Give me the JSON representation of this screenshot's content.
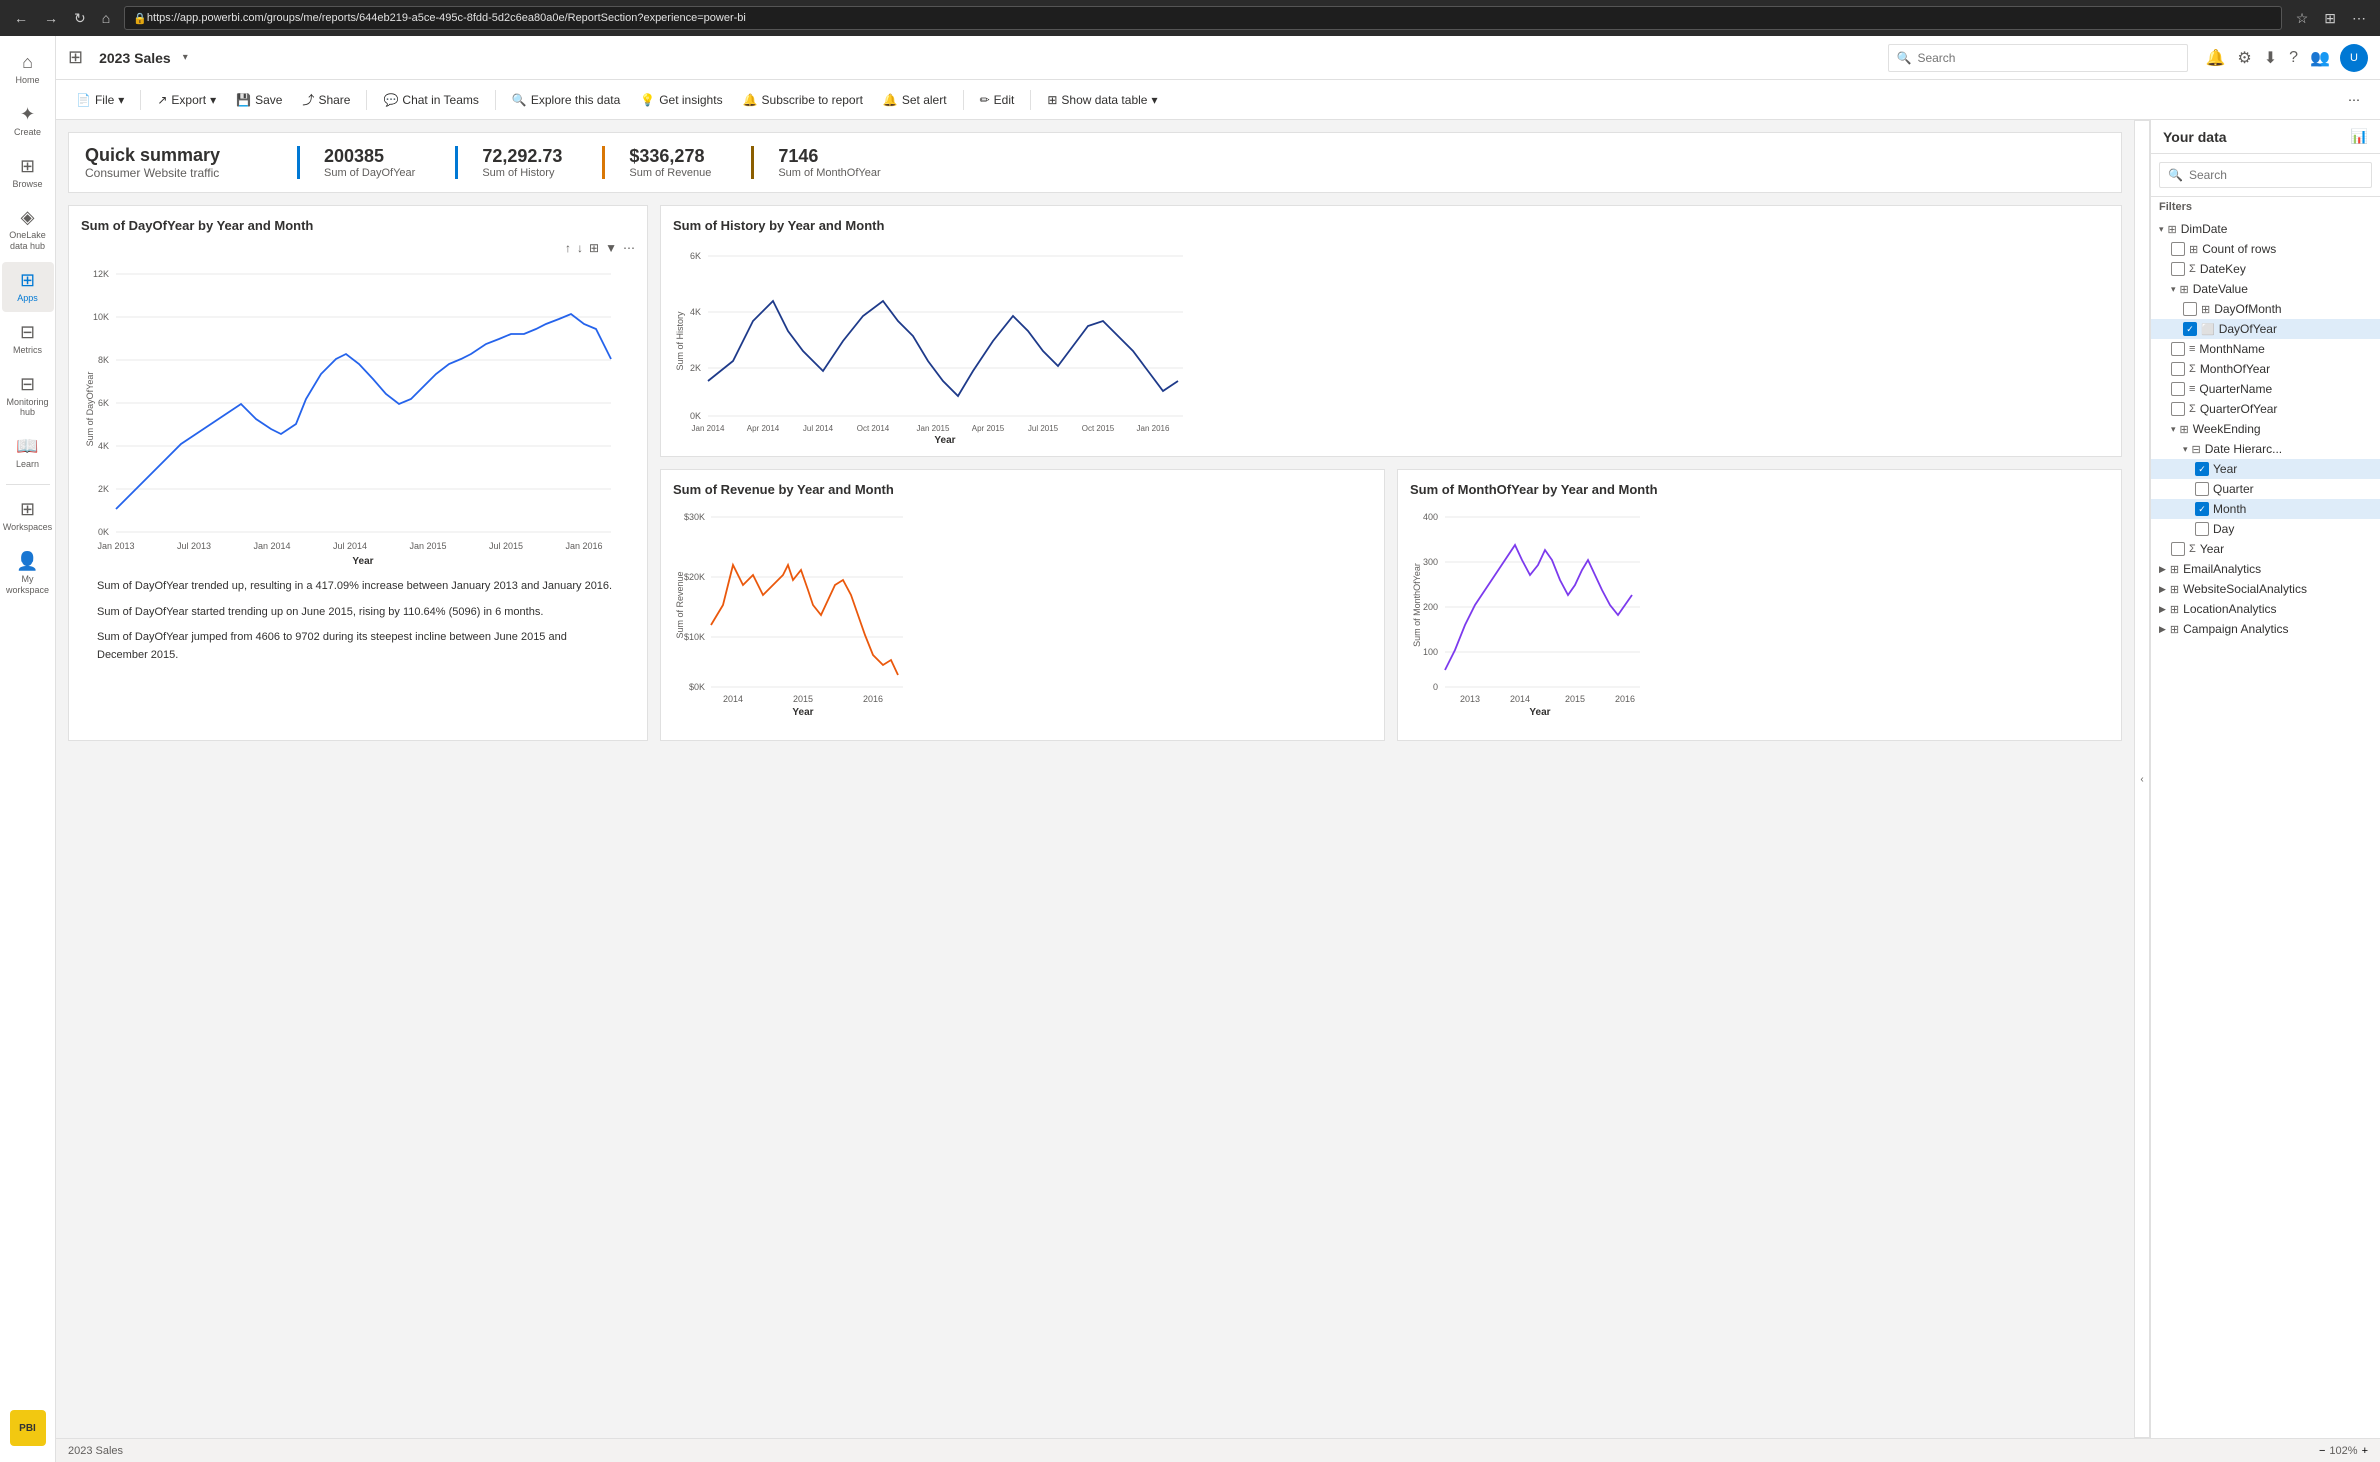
{
  "browser": {
    "url": "https://app.powerbi.com/groups/me/reports/644eb219-a5ce-495c-8fdd-5d2c6ea80a0e/ReportSection?experience=power-bi"
  },
  "topbar": {
    "report_title": "2023 Sales",
    "search_placeholder": "Search"
  },
  "toolbar": {
    "file": "File",
    "export": "Export",
    "save": "Save",
    "share": "Share",
    "chat_in_teams": "Chat in Teams",
    "explore_data": "Explore this data",
    "get_insights": "Get insights",
    "subscribe": "Subscribe to report",
    "set_alert": "Set alert",
    "edit": "Edit",
    "show_data_table": "Show data table"
  },
  "summary": {
    "title": "Quick summary",
    "subtitle": "Consumer Website traffic",
    "metrics": [
      {
        "value": "200385",
        "label": "Sum of DayOfYear",
        "color": "blue"
      },
      {
        "value": "72,292.73",
        "label": "Sum of History",
        "color": "blue"
      },
      {
        "value": "$336,278",
        "label": "Sum of Revenue",
        "color": "orange"
      },
      {
        "value": "7146",
        "label": "Sum of MonthOfYear",
        "color": "darkgold"
      }
    ]
  },
  "charts": {
    "chart1": {
      "title": "Sum of DayOfYear by Year and Month",
      "x_label": "Year",
      "y_label": "Sum of DayOfYear",
      "y_ticks": [
        "0K",
        "2K",
        "4K",
        "6K",
        "8K",
        "10K",
        "12K"
      ],
      "x_ticks": [
        "Jan 2013",
        "Jul 2013",
        "Jan 2014",
        "Jul 2014",
        "Jan 2015",
        "Jul 2015",
        "Jan 2016"
      ]
    },
    "chart2": {
      "title": "Sum of History by Year and Month",
      "x_label": "Year",
      "y_label": "Sum of History",
      "y_ticks": [
        "0K",
        "2K",
        "4K",
        "6K"
      ],
      "x_ticks": [
        "Jan 2014",
        "Apr 2014",
        "Jul 2014",
        "Oct 2014",
        "Jan 2015",
        "Apr 2015",
        "Jul 2015",
        "Oct 2015",
        "Jan 2016"
      ]
    },
    "chart3": {
      "title": "Sum of Revenue by Year and Month",
      "x_label": "Year",
      "y_label": "Sum of Revenue",
      "y_ticks": [
        "$0K",
        "$10K",
        "$20K",
        "$30K"
      ],
      "x_ticks": [
        "2014",
        "2015",
        "2016"
      ]
    },
    "chart4": {
      "title": "Sum of MonthOfYear by Year and Month",
      "x_label": "Year",
      "y_label": "Sum of MonthOfYear",
      "y_ticks": [
        "0",
        "100",
        "200",
        "300",
        "400"
      ],
      "x_ticks": [
        "2013",
        "2014",
        "2015",
        "2016"
      ]
    }
  },
  "insights": [
    "Sum of DayOfYear trended up, resulting in a 417.09% increase between January 2013 and January 2016.",
    "Sum of DayOfYear started trending up on June 2015, rising by 110.64% (5096) in 6 months.",
    "Sum of DayOfYear jumped from 4606 to 9702 during its steepest incline between June 2015 and December 2015."
  ],
  "right_panel": {
    "header": "Your data",
    "search_placeholder": "Search",
    "filters_label": "Filters",
    "tree": [
      {
        "label": "DimDate",
        "indent": 0,
        "expanded": true,
        "type": "table",
        "checked": false
      },
      {
        "label": "Count of rows",
        "indent": 1,
        "type": "measure",
        "checked": false
      },
      {
        "label": "DateKey",
        "indent": 1,
        "type": "sigma",
        "checked": false
      },
      {
        "label": "DateValue",
        "indent": 1,
        "expanded": true,
        "type": "table",
        "checked": false
      },
      {
        "label": "DayOfMonth",
        "indent": 2,
        "type": "table",
        "checked": false
      },
      {
        "label": "DayOfYear",
        "indent": 2,
        "type": "field",
        "checked": true,
        "highlighted": true
      },
      {
        "label": "MonthName",
        "indent": 1,
        "type": "field",
        "checked": false
      },
      {
        "label": "MonthOfYear",
        "indent": 1,
        "type": "sigma",
        "checked": false
      },
      {
        "label": "QuarterName",
        "indent": 1,
        "type": "field",
        "checked": false
      },
      {
        "label": "QuarterOfYear",
        "indent": 1,
        "type": "sigma",
        "checked": false
      },
      {
        "label": "WeekEnding",
        "indent": 1,
        "expanded": true,
        "type": "table",
        "checked": false
      },
      {
        "label": "Date Hierarc...",
        "indent": 2,
        "type": "hierarchy",
        "checked": false
      },
      {
        "label": "Year",
        "indent": 3,
        "type": "field",
        "checked": true,
        "highlighted": true
      },
      {
        "label": "Quarter",
        "indent": 3,
        "type": "field",
        "checked": false
      },
      {
        "label": "Month",
        "indent": 3,
        "type": "field",
        "checked": true,
        "highlighted": true
      },
      {
        "label": "Day",
        "indent": 3,
        "type": "field",
        "checked": false
      },
      {
        "label": "Year",
        "indent": 1,
        "type": "sigma",
        "checked": false
      },
      {
        "label": "EmailAnalytics",
        "indent": 0,
        "type": "table",
        "checked": false
      },
      {
        "label": "WebsiteSocialAnalytics",
        "indent": 0,
        "type": "table",
        "checked": false
      },
      {
        "label": "LocationAnalytics",
        "indent": 0,
        "type": "table",
        "checked": false
      },
      {
        "label": "Campaign Analytics",
        "indent": 0,
        "type": "table",
        "checked": false
      }
    ]
  },
  "sidebar": {
    "items": [
      {
        "icon": "⌂",
        "label": "Home"
      },
      {
        "icon": "+",
        "label": "Create"
      },
      {
        "icon": "⊞",
        "label": "Browse"
      },
      {
        "icon": "◈",
        "label": "OneLake data hub"
      },
      {
        "icon": "⊞",
        "label": "Apps",
        "active": true
      },
      {
        "icon": "◉",
        "label": "Metrics"
      },
      {
        "icon": "⊟",
        "label": "Monitoring hub"
      },
      {
        "icon": "☰",
        "label": "Learn"
      },
      {
        "icon": "⊞",
        "label": "Workspaces"
      },
      {
        "icon": "⊞",
        "label": "My workspace"
      }
    ]
  },
  "statusbar": {
    "zoom_label": "102%"
  }
}
